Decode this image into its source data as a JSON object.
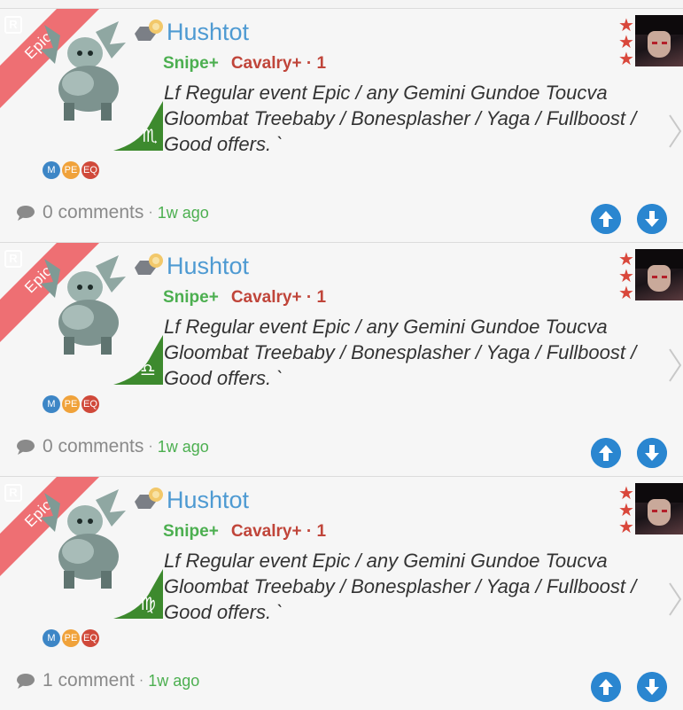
{
  "listings": [
    {
      "ribbon": "Epic",
      "rarity_badge": "R",
      "player": "Hushtot",
      "skills": {
        "snipe": "Snipe+",
        "cavalry": "Cavalry+ · 1"
      },
      "description": "Lf Regular event Epic / any Gemini Gundoe Toucva Gloombat Treebaby / Bonesplasher / Yaga / Fullboost / Good offers. `",
      "zodiac_symbol": "♏",
      "zodiac_icon": "scorpio-icon",
      "tags": [
        "M",
        "PE",
        "EQ"
      ],
      "comments": "0 comments",
      "dot": "·",
      "time": "1w ago",
      "stars": [
        "★",
        "★",
        "★"
      ]
    },
    {
      "ribbon": "Epic",
      "rarity_badge": "R",
      "player": "Hushtot",
      "skills": {
        "snipe": "Snipe+",
        "cavalry": "Cavalry+ · 1"
      },
      "description": "Lf Regular event Epic / any Gemini Gundoe Toucva Gloombat Treebaby / Bonesplasher / Yaga / Fullboost / Good offers. `",
      "zodiac_symbol": "♎",
      "zodiac_icon": "libra-icon",
      "tags": [
        "M",
        "PE",
        "EQ"
      ],
      "comments": "0 comments",
      "dot": "·",
      "time": "1w ago",
      "stars": [
        "★",
        "★",
        "★"
      ]
    },
    {
      "ribbon": "Epic",
      "rarity_badge": "R",
      "player": "Hushtot",
      "skills": {
        "snipe": "Snipe+",
        "cavalry": "Cavalry+ · 1"
      },
      "description": "Lf Regular event Epic / any Gemini Gundoe Toucva Gloombat Treebaby / Bonesplasher / Yaga / Fullboost / Good offers. `",
      "zodiac_symbol": "♍",
      "zodiac_icon": "virgo-icon",
      "tags": [
        "M",
        "PE",
        "EQ"
      ],
      "comments": "1 comment",
      "dot": "·",
      "time": "1w ago",
      "stars": [
        "★",
        "★",
        "★"
      ]
    }
  ],
  "colors": {
    "ribbon": "#ee6f73",
    "player_name": "#4e9ad2",
    "snipe": "#4caf50",
    "cavalry": "#c0453a",
    "zodiac_green": "#3d8a2e",
    "vote_button": "#2a86d0",
    "star": "#d9473b"
  }
}
